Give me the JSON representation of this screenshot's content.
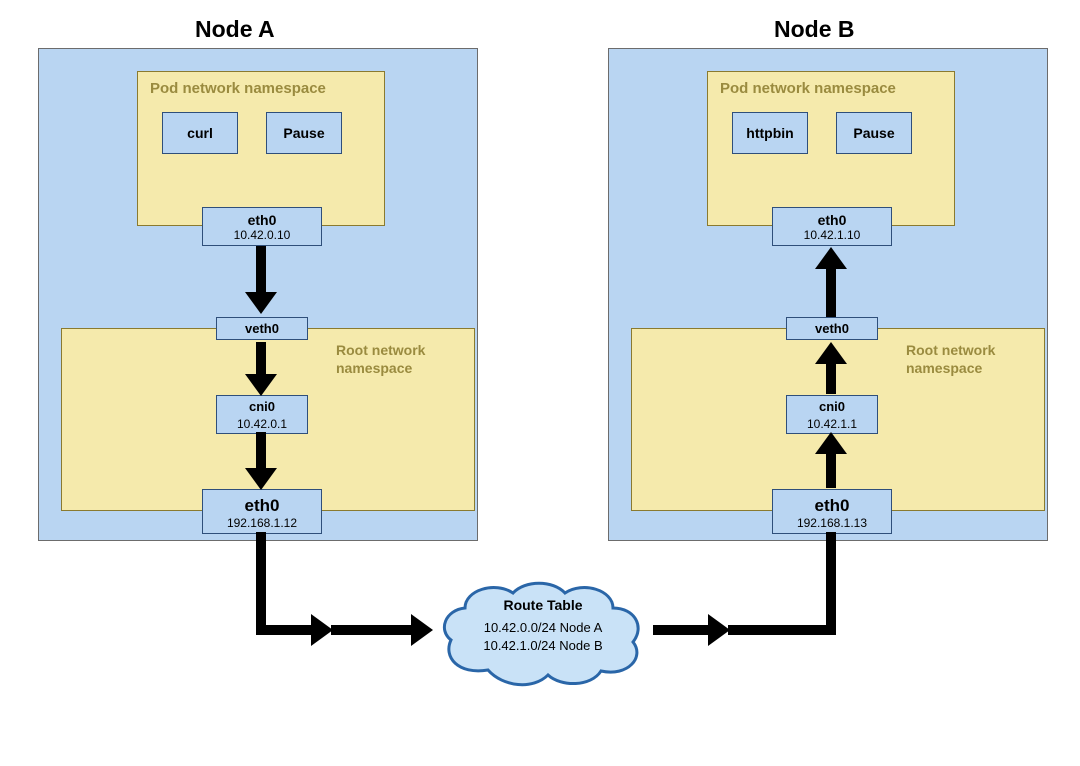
{
  "nodes": {
    "a": {
      "title": "Node A",
      "pod_ns_label": "Pod network namespace",
      "app1": "curl",
      "app2": "Pause",
      "pod_eth": {
        "name": "eth0",
        "ip": "10.42.0.10"
      },
      "root_ns_label": "Root network\nnamespace",
      "veth": "veth0",
      "cni": {
        "name": "cni0",
        "ip": "10.42.0.1"
      },
      "host_eth": {
        "name": "eth0",
        "ip": "192.168.1.12"
      }
    },
    "b": {
      "title": "Node B",
      "pod_ns_label": "Pod network namespace",
      "app1": "httpbin",
      "app2": "Pause",
      "pod_eth": {
        "name": "eth0",
        "ip": "10.42.1.10"
      },
      "root_ns_label": "Root network\nnamespace",
      "veth": "veth0",
      "cni": {
        "name": "cni0",
        "ip": "10.42.1.1"
      },
      "host_eth": {
        "name": "eth0",
        "ip": "192.168.1.13"
      }
    }
  },
  "route_table": {
    "title": "Route Table",
    "routes": [
      "10.42.0.0/24 Node A",
      "10.42.1.0/24 Node B"
    ]
  }
}
